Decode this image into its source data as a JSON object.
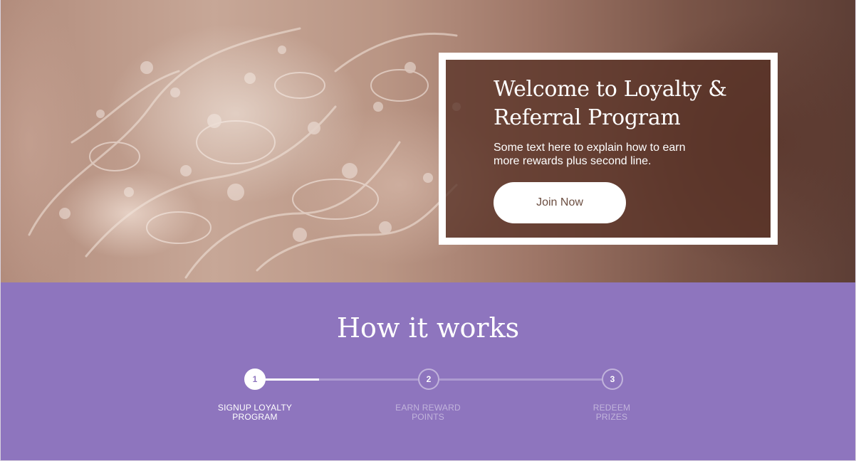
{
  "hero": {
    "title": "Welcome to Loyalty & Referral Program",
    "description": "Some text here to explain how to earn more rewards plus second line.",
    "cta_label": "Join Now"
  },
  "how_it_works": {
    "title": "How it works",
    "progress_fraction": 0.18,
    "steps": [
      {
        "number": "1",
        "label": "SIGNUP LOYALTY PROGRAM",
        "active": true
      },
      {
        "number": "2",
        "label": "EARN REWARD POINTS",
        "active": false
      },
      {
        "number": "3",
        "label": "REDEEM PRIZES",
        "active": false
      }
    ]
  },
  "colors": {
    "section_purple": "#8e75be",
    "overlay_brown": "#583226",
    "button_text": "#6b4d40",
    "white": "#ffffff"
  }
}
